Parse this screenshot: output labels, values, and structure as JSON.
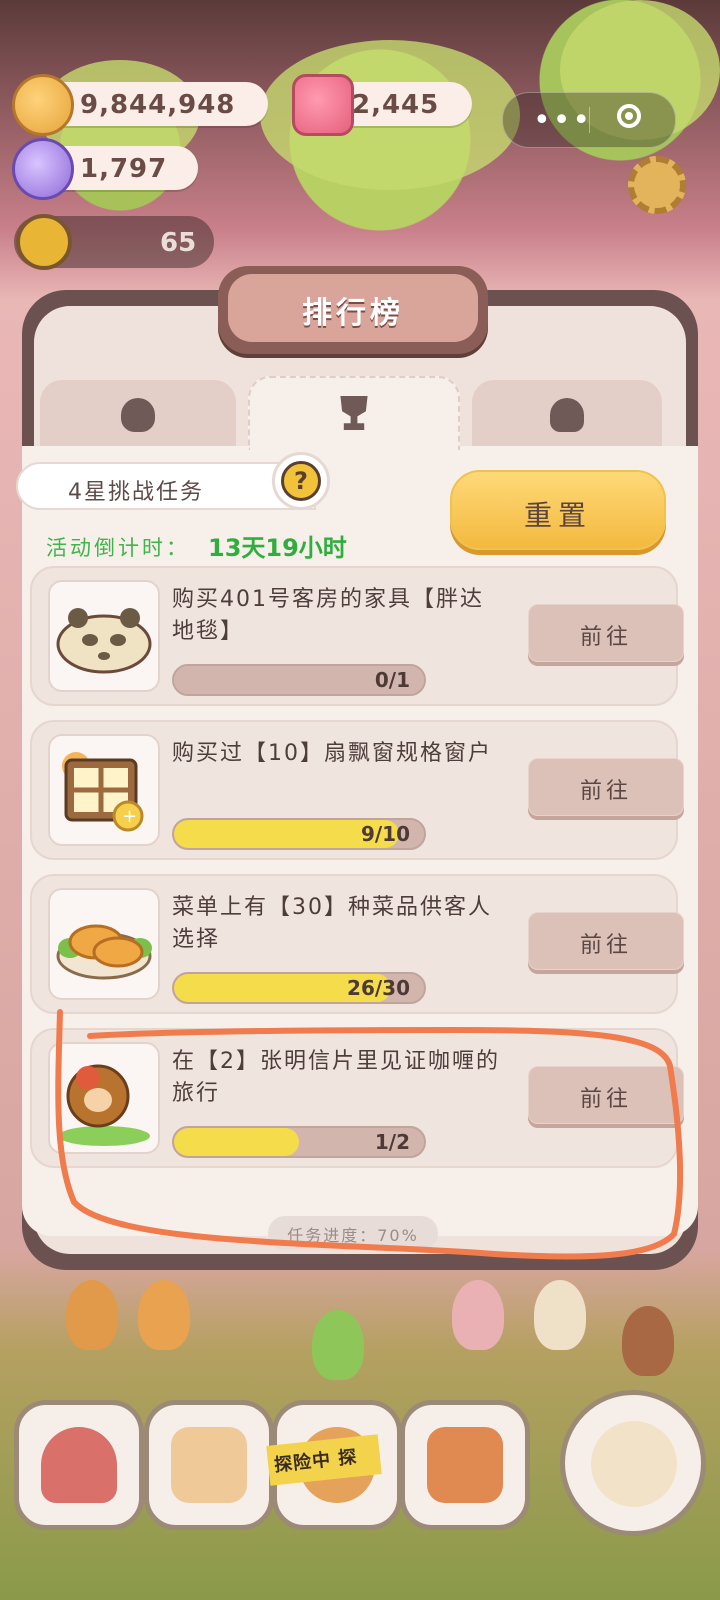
{
  "currencies": {
    "coins": "9,844,948",
    "gems": "2,445",
    "candy": "1,797"
  },
  "level": "65",
  "panel": {
    "title": "排行榜",
    "tabs": [
      "people-tab",
      "trophy-tab",
      "mushroom-tab"
    ],
    "active_tab": 1
  },
  "challenge": {
    "label": "4星挑战任务",
    "help": "?",
    "reset_label": "重置",
    "countdown_label": "活动倒计时：",
    "countdown_value": "13天19小时"
  },
  "tasks": [
    {
      "desc": "购买401号客房的家具【胖达地毯】",
      "progress": "0/1",
      "fraction": 0.0,
      "go": "前往"
    },
    {
      "desc": "购买过【10】扇飘窗规格窗户",
      "progress": "9/10",
      "fraction": 0.9,
      "go": "前往"
    },
    {
      "desc": "菜单上有【30】种菜品供客人选择",
      "progress": "26/30",
      "fraction": 0.867,
      "go": "前往"
    },
    {
      "desc": "在【2】张明信片里见证咖喱的旅行",
      "progress": "1/2",
      "fraction": 0.5,
      "go": "前往"
    }
  ],
  "task_progress": "任务进度：70%",
  "dock": {
    "adventure_tag": "探险中 探"
  },
  "colors": {
    "accent_yellow": "#f5dc4a",
    "countdown_green": "#2fae3e",
    "annotation_orange": "#f07b4c"
  }
}
